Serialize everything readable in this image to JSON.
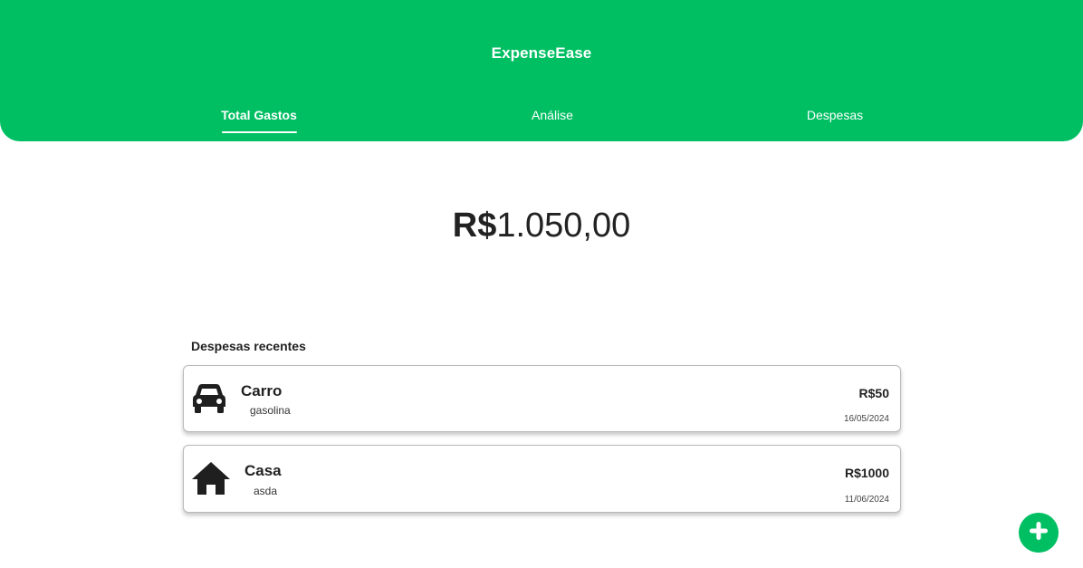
{
  "header": {
    "app_title": "ExpenseEase",
    "tabs": [
      {
        "label": "Total Gastos",
        "active": true
      },
      {
        "label": "Análise",
        "active": false
      },
      {
        "label": "Despesas",
        "active": false
      }
    ]
  },
  "total": {
    "currency": "R$",
    "value": "1.050,00"
  },
  "recent": {
    "title": "Despesas recentes",
    "items": [
      {
        "name": "Carro",
        "description": "gasolina",
        "amount": "R$50",
        "date": "16/05/2024",
        "icon": "car-icon"
      },
      {
        "name": "Casa",
        "description": "asda",
        "amount": "R$1000",
        "date": "11/06/2024",
        "icon": "house-icon"
      }
    ]
  },
  "fab": {
    "icon": "plus-icon"
  },
  "colors": {
    "accent": "#00bf63",
    "text": "#222222",
    "card_border": "#b9b9b9"
  }
}
